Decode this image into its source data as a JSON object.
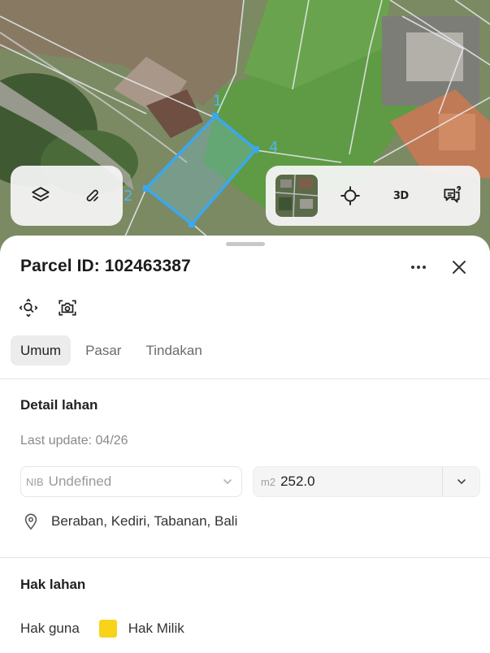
{
  "map": {
    "parcel_vertex_labels": [
      "1",
      "2",
      "4"
    ],
    "colors": {
      "parcel_outline": "#3aa8f0",
      "parcel_fill": "rgba(120,200,240,0.28)",
      "parcel_line_lines": "#e8ecef"
    }
  },
  "controls": {
    "left": [
      {
        "name": "layers-icon"
      },
      {
        "name": "draw-path-icon"
      }
    ],
    "right": [
      {
        "name": "satellite-thumbnail"
      },
      {
        "name": "locate-icon"
      },
      {
        "name": "3d-toggle",
        "label": "3D"
      },
      {
        "name": "feedback-icon"
      }
    ]
  },
  "sheet": {
    "title": "Parcel ID: 102463387",
    "tabs": [
      {
        "label": "Umum",
        "active": true
      },
      {
        "label": "Pasar",
        "active": false
      },
      {
        "label": "Tindakan",
        "active": false
      }
    ],
    "detail": {
      "section_title": "Detail lahan",
      "last_update": "Last update: 04/26",
      "nib_prefix": "NIB",
      "nib_value": "Undefined",
      "area_prefix": "m2",
      "area_value": "252.0",
      "location": "Beraban, Kediri, Tabanan, Bali"
    },
    "rights": {
      "section_title": "Hak lahan",
      "label": "Hak guna",
      "value": "Hak Milik",
      "swatch_color": "#f7d31a"
    }
  }
}
